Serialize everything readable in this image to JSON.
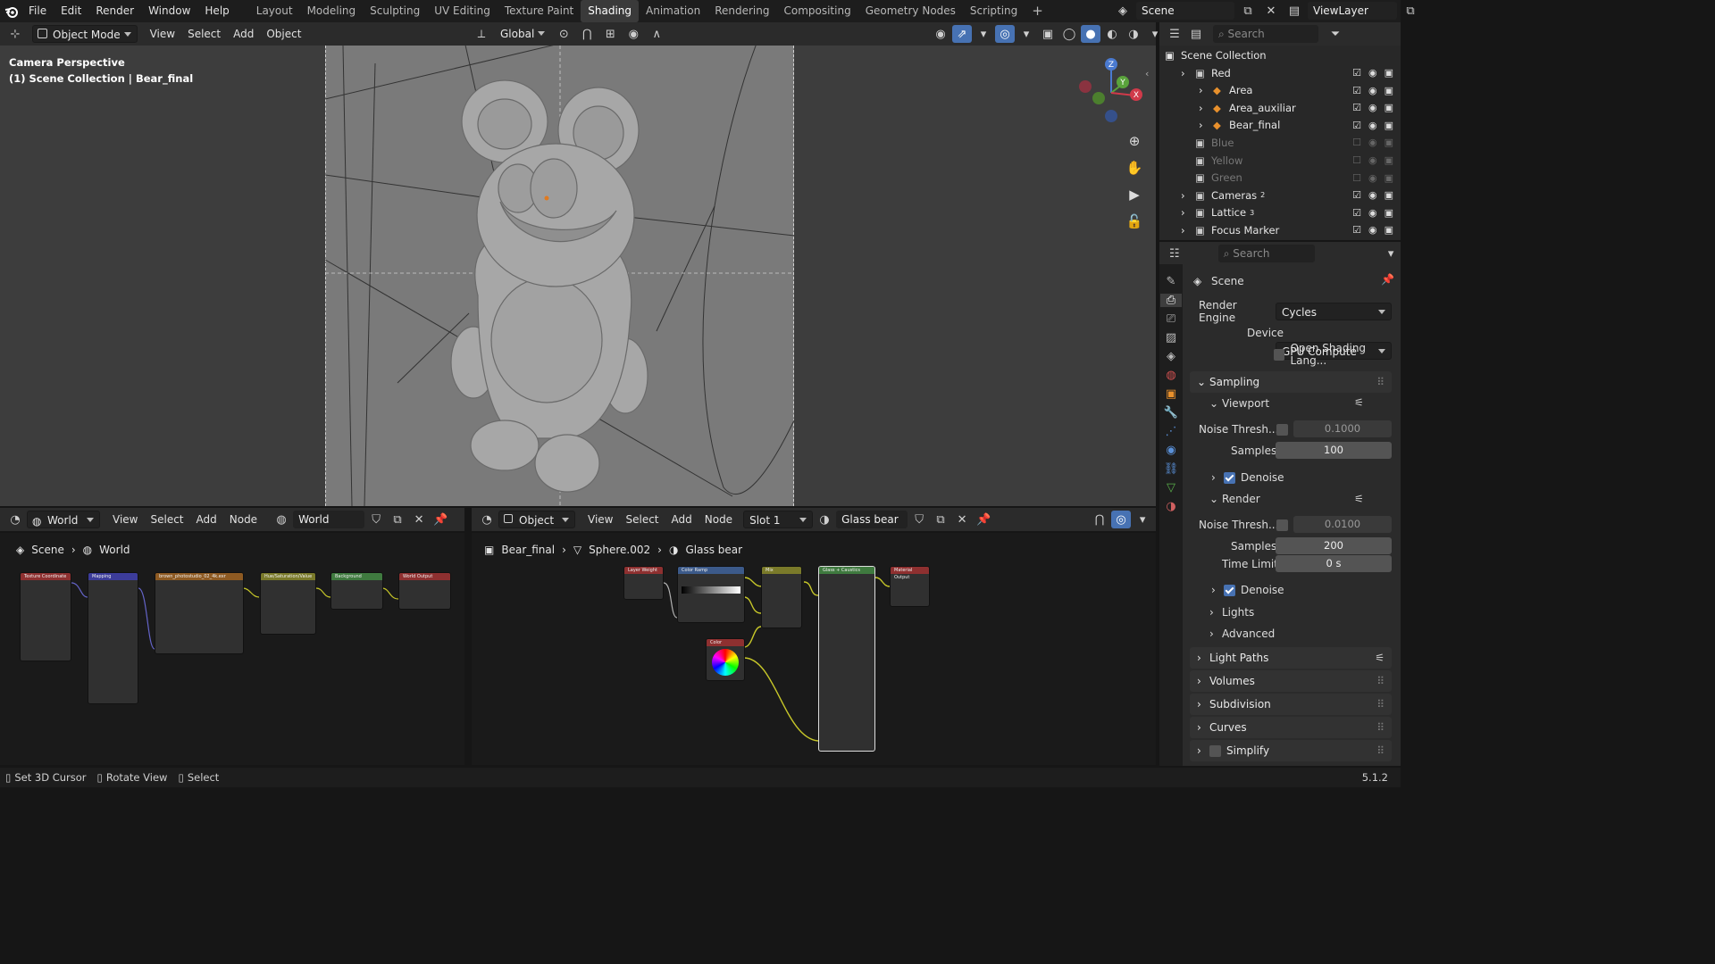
{
  "topbar": {
    "menus": [
      "File",
      "Edit",
      "Render",
      "Window",
      "Help"
    ],
    "workspaces": [
      "Layout",
      "Modeling",
      "Sculpting",
      "UV Editing",
      "Texture Paint",
      "Shading",
      "Animation",
      "Rendering",
      "Compositing",
      "Geometry Nodes",
      "Scripting"
    ],
    "active_workspace": "Shading",
    "scene_name": "Scene",
    "view_layer": "ViewLayer"
  },
  "viewport": {
    "mode": "Object Mode",
    "menus": [
      "View",
      "Select",
      "Add",
      "Object"
    ],
    "orientation": "Global",
    "overlay_title": "Camera Perspective",
    "overlay_subtitle": "(1) Scene Collection | Bear_final",
    "gizmo_axes": [
      "Z",
      "Y",
      "X"
    ]
  },
  "world_editor": {
    "type": "World",
    "menus": [
      "View",
      "Select",
      "Add",
      "Node"
    ],
    "world_name": "World",
    "breadcrumb": [
      "Scene",
      "World"
    ],
    "nodes": [
      {
        "title": "Texture Coordinate",
        "color": "#8e3030"
      },
      {
        "title": "Mapping",
        "color": "#3c3c9a"
      },
      {
        "title": "brown_photostudio_02_4k.exr",
        "color": "#8e5a22"
      },
      {
        "title": "Hue/Saturation/Value",
        "color": "#7a7a2a"
      },
      {
        "title": "Background",
        "color": "#3f7a3f"
      },
      {
        "title": "World Output",
        "color": "#8e3030"
      }
    ]
  },
  "shader_editor": {
    "type": "Object",
    "menus": [
      "View",
      "Select",
      "Add",
      "Node"
    ],
    "slot": "Slot 1",
    "material": "Glass bear",
    "breadcrumb": [
      "Bear_final",
      "Sphere.002",
      "Glass bear"
    ],
    "nodes": [
      {
        "title": "Layer Weight",
        "color": "#8e3030"
      },
      {
        "title": "Color Ramp",
        "color": "#3c5a8a"
      },
      {
        "title": "Mix",
        "color": "#7a7a2a"
      },
      {
        "title": "Color",
        "color": "#8e3030"
      },
      {
        "title": "Glass + Caustics",
        "color": "#3f7a3f"
      },
      {
        "title": "Material Output",
        "color": "#8e3030"
      }
    ]
  },
  "outliner": {
    "search_placeholder": "Search",
    "root": "Scene Collection",
    "items": [
      {
        "label": "Red",
        "level": 1,
        "enabled": true
      },
      {
        "label": "Area",
        "level": 2,
        "enabled": true
      },
      {
        "label": "Area_auxiliar",
        "level": 2,
        "enabled": true
      },
      {
        "label": "Bear_final",
        "level": 2,
        "enabled": true
      },
      {
        "label": "Blue",
        "level": 1,
        "enabled": false
      },
      {
        "label": "Yellow",
        "level": 1,
        "enabled": false
      },
      {
        "label": "Green",
        "level": 1,
        "enabled": false
      },
      {
        "label": "Cameras",
        "level": 1,
        "enabled": true,
        "badge": "2"
      },
      {
        "label": "Lattice",
        "level": 1,
        "enabled": true,
        "badge": "3"
      },
      {
        "label": "Focus Marker",
        "level": 1,
        "enabled": true
      }
    ]
  },
  "properties": {
    "search_placeholder": "Search",
    "context": "Scene",
    "render_engine_label": "Render Engine",
    "render_engine": "Cycles",
    "device_label": "Device",
    "device": "GPU Compute",
    "osl_label": "Open Shading Lang...",
    "sampling": "Sampling",
    "viewport_label": "Viewport",
    "noise_label": "Noise Thresh...",
    "viewport_noise": "0.1000",
    "samples_label": "Samples",
    "viewport_samples": "100",
    "denoise_label": "Denoise",
    "render_label": "Render",
    "render_noise": "0.0100",
    "render_samples": "200",
    "time_limit_label": "Time Limit",
    "time_limit": "0 s",
    "lights": "Lights",
    "advanced": "Advanced",
    "panels": [
      "Light Paths",
      "Volumes",
      "Subdivision",
      "Curves",
      "Simplify"
    ]
  },
  "statusbar": {
    "items": [
      "Set 3D Cursor",
      "Rotate View",
      "Select"
    ],
    "version": "5.1.2"
  },
  "colors": {
    "accent": "#4772b3",
    "active_ws": "#3a3a3a"
  }
}
